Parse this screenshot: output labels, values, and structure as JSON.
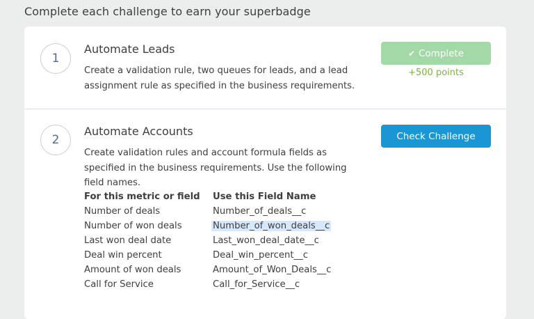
{
  "page": {
    "heading": "Complete each challenge to earn your superbadge"
  },
  "challenges": [
    {
      "number": "1",
      "title": "Automate Leads",
      "description": "Create a validation rule, two queues for leads, and a lead assignment rule as specified in the business requirements.",
      "button_label": "Complete",
      "button_icon": "check-icon",
      "points": "+500 points"
    },
    {
      "number": "2",
      "title": "Automate Accounts",
      "description": "Create validation rules and account formula fields as specified in the business requirements. Use the following field names.",
      "button_label": "Check Challenge"
    }
  ],
  "field_table": {
    "headers": [
      "For this metric or field",
      "Use this Field Name"
    ],
    "rows": [
      [
        "Number of deals",
        "Number_of_deals__c"
      ],
      [
        "Number of won deals",
        "Number_of_won_deals__c"
      ],
      [
        "Last won deal date",
        "Last_won_deal_date__c"
      ],
      [
        "Deal win percent",
        "Deal_win_percent__c"
      ],
      [
        "Amount of won deals",
        "Amount_of_Won_Deals__c"
      ],
      [
        "Call for Service",
        "Call_for_Service__c"
      ]
    ],
    "highlighted_cell": "Number_of_won_deals__c"
  },
  "colors": {
    "complete_button": "#a3d9a6",
    "check_button": "#1b96d4",
    "points_text": "#7cb342",
    "selection_highlight": "#d6e8fb"
  }
}
